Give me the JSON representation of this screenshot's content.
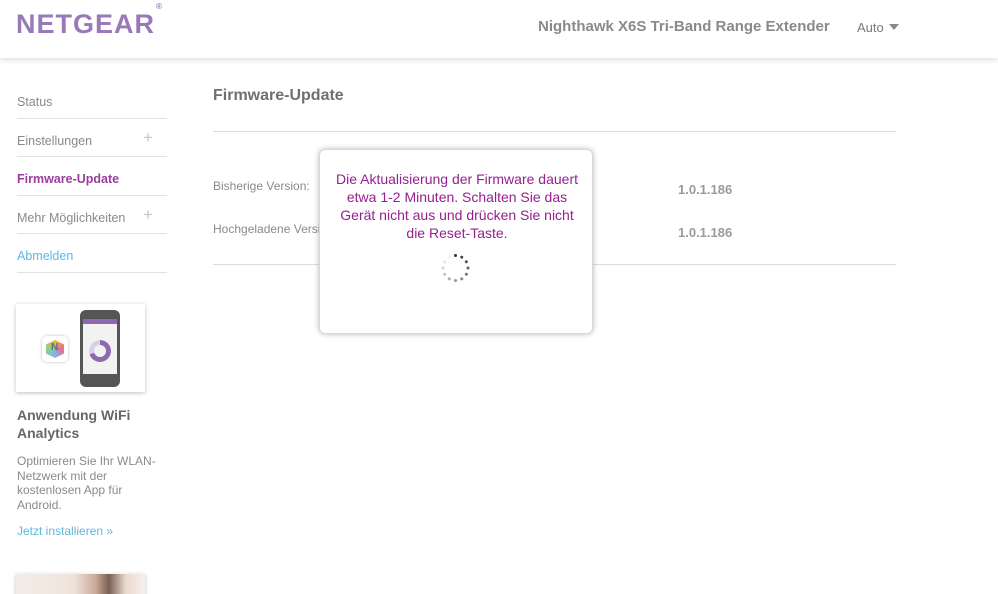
{
  "header": {
    "logo_text": "NETGEAR",
    "logo_mark": "®",
    "product_name": "Nighthawk X6S Tri-Band Range Extender",
    "language": "Auto"
  },
  "sidebar": {
    "items": [
      {
        "label": "Status"
      },
      {
        "label": "Einstellungen",
        "expand": "+"
      },
      {
        "label": "Firmware-Update"
      },
      {
        "label": "Mehr Möglichkeiten",
        "expand": "+"
      },
      {
        "label": "Abmelden"
      }
    ],
    "promo": {
      "title": "Anwendung WiFi Analytics",
      "text": "Optimieren Sie Ihr WLAN-Netzwerk mit der kostenlosen App für Android.",
      "link": "Jetzt installieren »"
    }
  },
  "main": {
    "title": "Firmware-Update",
    "rows": [
      {
        "label": "Bisherige Version:",
        "value": "1.0.1.186"
      },
      {
        "label": "Hochgeladene Version:",
        "value": "1.0.1.186"
      }
    ]
  },
  "modal": {
    "message": "Die Aktualisierung der Firmware dauert etwa 1-2 Minuten. Schalten Sie das Gerät nicht aus und drücken Sie nicht die Reset-Taste."
  },
  "colors": {
    "brand_purple": "#9a79b9",
    "active_nav": "#9a3d9e",
    "link_blue": "#5bb8e6",
    "modal_text": "#95208f"
  },
  "icons": {
    "expand": "plus-icon",
    "language_dropdown": "caret-down-icon",
    "loading": "spinner-icon"
  }
}
